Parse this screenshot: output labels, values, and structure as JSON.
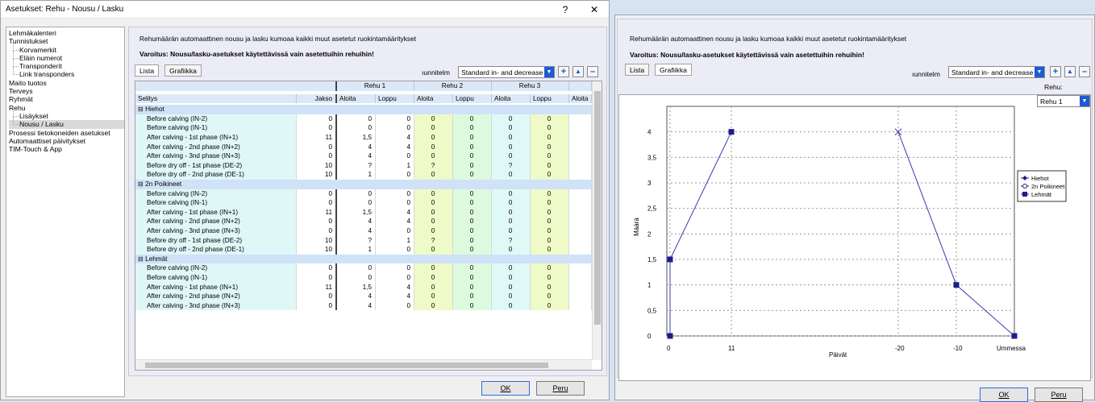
{
  "left_window": {
    "title": "Asetukset: Rehu - Nousu / Lasku",
    "help_label": "?",
    "close_label": "✕",
    "tree": [
      {
        "label": "Lehmäkalenteri",
        "level": 1,
        "selected": false
      },
      {
        "label": "Tunnistukset",
        "level": 1,
        "selected": false
      },
      {
        "label": "Korvamerkit",
        "level": 2,
        "selected": false
      },
      {
        "label": "Eläin numerot",
        "level": 2,
        "selected": false
      },
      {
        "label": "Transponderit",
        "level": 2,
        "selected": false
      },
      {
        "label": "Link transponders",
        "level": 2,
        "selected": false
      },
      {
        "label": "Maito tuotos",
        "level": 1,
        "selected": false
      },
      {
        "label": "Terveys",
        "level": 1,
        "selected": false
      },
      {
        "label": "Ryhmät",
        "level": 1,
        "selected": false
      },
      {
        "label": "Rehu",
        "level": 1,
        "selected": false
      },
      {
        "label": "Lisäykset",
        "level": 2,
        "selected": false
      },
      {
        "label": "Nousu / Lasku",
        "level": 2,
        "selected": true
      },
      {
        "label": "Prosessi tietokoneiden asetukset",
        "level": 1,
        "selected": false
      },
      {
        "label": "Automaattiset päivitykset",
        "level": 1,
        "selected": false
      },
      {
        "label": "TIM-Touch & App",
        "level": 1,
        "selected": false
      }
    ],
    "note": "Rehumäärän automaattinen nousu ja lasku kumoaa kaikki muut asetetut ruokintamääritykset",
    "warning": "Varoitus: Nousu/lasku-asetukset käytettävissä vain asetettuihin rehuihin!",
    "tab_list": "Lista",
    "tab_graph": "Grafiikka",
    "plan_label": "ıunnitelm",
    "plan_value": "Standard in- and decrease",
    "plus": "+",
    "up": "▲",
    "minus": "–",
    "grid": {
      "feed_headers": [
        "Rehu 1",
        "Rehu 2",
        "Rehu 3"
      ],
      "col_headers": [
        "Selitys",
        "Jakso",
        "Aloita",
        "Loppu",
        "Aloita",
        "Loppu",
        "Aloita",
        "Loppu",
        "Aloita"
      ],
      "groups": [
        {
          "name": "Hiehot",
          "rows": [
            [
              "Before calving (IN-2)",
              "0",
              "0",
              "0",
              "0",
              "0",
              "0",
              "0"
            ],
            [
              "Before calving (IN-1)",
              "0",
              "0",
              "0",
              "0",
              "0",
              "0",
              "0"
            ],
            [
              "After calving - 1st phase (IN+1)",
              "11",
              "1,5",
              "4",
              "0",
              "0",
              "0",
              "0"
            ],
            [
              "After calving - 2nd phase (IN+2)",
              "0",
              "4",
              "4",
              "0",
              "0",
              "0",
              "0"
            ],
            [
              "After calving - 3nd phase (IN+3)",
              "0",
              "4",
              "0",
              "0",
              "0",
              "0",
              "0"
            ],
            [
              "Before dry off - 1st phase (DE-2)",
              "10",
              "?",
              "1",
              "?",
              "0",
              "?",
              "0"
            ],
            [
              "Before dry off - 2nd phase (DE-1)",
              "10",
              "1",
              "0",
              "0",
              "0",
              "0",
              "0"
            ]
          ]
        },
        {
          "name": "2n Poikineet",
          "rows": [
            [
              "Before calving (IN-2)",
              "0",
              "0",
              "0",
              "0",
              "0",
              "0",
              "0"
            ],
            [
              "Before calving (IN-1)",
              "0",
              "0",
              "0",
              "0",
              "0",
              "0",
              "0"
            ],
            [
              "After calving - 1st phase (IN+1)",
              "11",
              "1,5",
              "4",
              "0",
              "0",
              "0",
              "0"
            ],
            [
              "After calving - 2nd phase (IN+2)",
              "0",
              "4",
              "4",
              "0",
              "0",
              "0",
              "0"
            ],
            [
              "After calving - 3nd phase (IN+3)",
              "0",
              "4",
              "0",
              "0",
              "0",
              "0",
              "0"
            ],
            [
              "Before dry off - 1st phase (DE-2)",
              "10",
              "?",
              "1",
              "?",
              "0",
              "?",
              "0"
            ],
            [
              "Before dry off - 2nd phase (DE-1)",
              "10",
              "1",
              "0",
              "0",
              "0",
              "0",
              "0"
            ]
          ]
        },
        {
          "name": "Lehmät",
          "rows": [
            [
              "Before calving (IN-2)",
              "0",
              "0",
              "0",
              "0",
              "0",
              "0",
              "0"
            ],
            [
              "Before calving (IN-1)",
              "0",
              "0",
              "0",
              "0",
              "0",
              "0",
              "0"
            ],
            [
              "After calving - 1st phase (IN+1)",
              "11",
              "1,5",
              "4",
              "0",
              "0",
              "0",
              "0"
            ],
            [
              "After calving - 2nd phase (IN+2)",
              "0",
              "4",
              "4",
              "0",
              "0",
              "0",
              "0"
            ],
            [
              "After calving - 3nd phase (IN+3)",
              "0",
              "4",
              "0",
              "0",
              "0",
              "0",
              "0"
            ]
          ]
        }
      ]
    },
    "ok_label": "OK",
    "cancel_label": "Peru"
  },
  "right_window": {
    "note": "Rehumäärän automaattinen nousu ja lasku kumoaa kaikki muut asetetut ruokintamääritykset",
    "warning": "Varoitus: Nousu/lasku-asetukset käytettävissä vain asetettuihin rehuihin!",
    "tab_list": "Lista",
    "tab_graph": "Grafiikka",
    "plan_label": "ıunnitelm",
    "plan_value": "Standard in- and decrease",
    "feed_label": "Rehu:",
    "feed_value": "Rehu 1",
    "plus": "+",
    "up": "▲",
    "minus": "–",
    "ok_label": "OK",
    "cancel_label": "Peru"
  },
  "chart_data": {
    "type": "line",
    "ylabel": "Määrä",
    "xlabel": "Päivät",
    "ylim": [
      0,
      4.5
    ],
    "yticks": [
      "0",
      "0,5",
      "1",
      "1,5",
      "2",
      "2,5",
      "3",
      "3,5",
      "4"
    ],
    "xtick_labels": [
      "0",
      "11",
      "-20",
      "-10",
      "Ummessa"
    ],
    "grid": true,
    "legend_position": "right",
    "series": [
      {
        "name": "Hiehot",
        "color": "#1c1c8c",
        "marker": "diamond"
      },
      {
        "name": "2n Poikineet",
        "color": "#1c1c8c",
        "marker": "circle"
      },
      {
        "name": "Lehmät",
        "color": "#1c1c8c",
        "marker": "square"
      }
    ],
    "segments": [
      {
        "points": [
          {
            "x": "0",
            "y": 0
          },
          {
            "x": "0",
            "y": 1.5
          },
          {
            "x": "11",
            "y": 4
          }
        ]
      },
      {
        "points": [
          {
            "x": "-20",
            "y": 4
          },
          {
            "x": "-10",
            "y": 1
          },
          {
            "x": "Ummessa",
            "y": 0
          }
        ]
      }
    ]
  }
}
